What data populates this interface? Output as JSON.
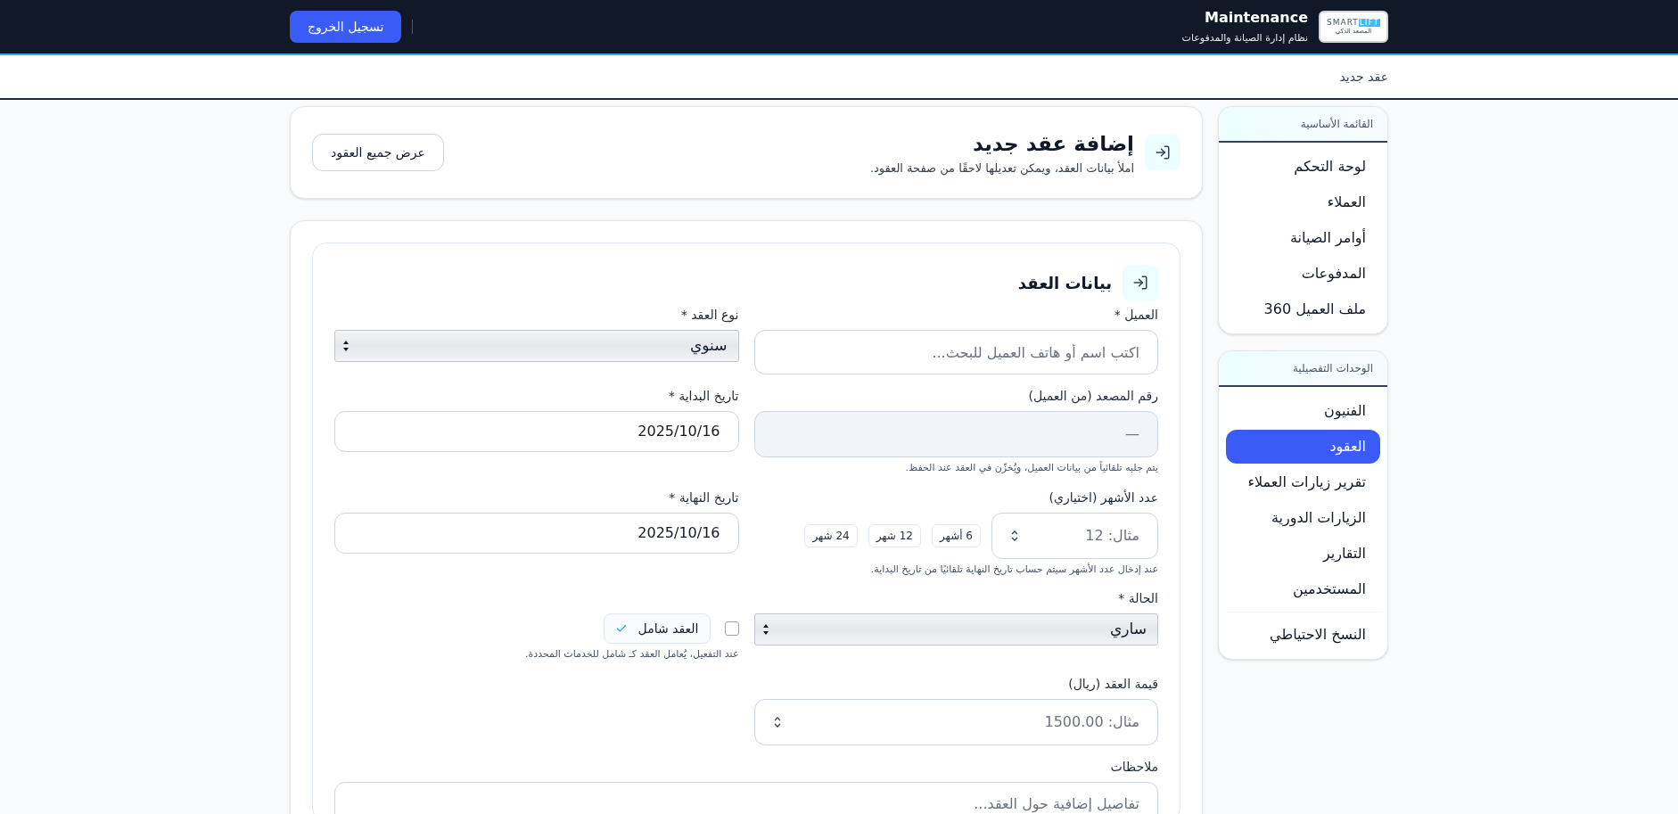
{
  "header": {
    "logo": {
      "word_1": "SMART",
      "word_2": "LIFT",
      "tagline": "المصعد الذكي"
    },
    "title": "Maintenance",
    "subtitle": "نظام إدارة الصيانة والمدفوعات",
    "logout_button": "تسجيل الخروج"
  },
  "breadcrumb": "عقد جديد",
  "sidebar": {
    "sections": [
      {
        "title": "القائمة الأساسية",
        "items": [
          {
            "label": "لوحة التحكم",
            "selected": false
          },
          {
            "label": "العملاء",
            "selected": false
          },
          {
            "label": "أوامر الصيانة",
            "selected": false
          },
          {
            "label": "المدفوعات",
            "selected": false
          },
          {
            "label": "ملف العميل 360",
            "selected": false
          }
        ]
      },
      {
        "title": "الوحدات التفصيلية",
        "items": [
          {
            "label": "الفنيون",
            "selected": false
          },
          {
            "label": "العقود",
            "selected": true
          },
          {
            "label": "تقرير زيارات العملاء",
            "selected": false
          },
          {
            "label": "الزيارات الدورية",
            "selected": false
          },
          {
            "label": "التقارير",
            "selected": false
          },
          {
            "label": "المستخدمين",
            "selected": false
          }
        ],
        "footer_items": [
          {
            "label": "النسخ الاحتياطي",
            "selected": false
          }
        ]
      }
    ]
  },
  "page_header": {
    "title": "إضافة عقد جديد",
    "subtitle": "املأ بيانات العقد، ويمكن تعديلها لاحقًا من صفحة العقود.",
    "button": "عرض جميع العقود"
  },
  "form": {
    "title": "بيانات العقد",
    "rows": [
      {
        "fields": [
          {
            "kind": "text",
            "label": "العميل *",
            "placeholder": "اكتب اسم أو هاتف العميل للبحث..."
          },
          {
            "kind": "select",
            "label": "نوع العقد *",
            "value": "سنوي"
          }
        ]
      },
      {
        "fields": [
          {
            "kind": "readonly",
            "label": "رقم المصعد (من العميل)",
            "value": "—",
            "hint": "يتم جلبه تلقائياً من بيانات العميل، ويُخزّن في العقد عند الحفظ."
          },
          {
            "kind": "date",
            "label": "تاريخ البداية *",
            "value": "2025/10/16"
          }
        ]
      },
      {
        "fields": [
          {
            "kind": "number",
            "label": "عدد الأشهر (اختياري)",
            "placeholder": "مثال: 12",
            "chips": [
              "6 أشهر",
              "12 شهر",
              "24 شهر"
            ],
            "hint": "عند إدخال عدد الأشهر سيتم حساب تاريخ النهاية تلقائيًا من تاريخ البداية."
          },
          {
            "kind": "date",
            "label": "تاريخ النهاية *",
            "value": "2025/10/16"
          }
        ]
      },
      {
        "fields": [
          {
            "kind": "select",
            "label": "الحالة *",
            "value": "ساري"
          },
          {
            "kind": "checkbox",
            "label": "العقد شامل",
            "checked": false,
            "hint": "عند التفعيل، يُعامل العقد كـ شامل للخدمات المحددة."
          }
        ]
      },
      {
        "fields": [
          {
            "kind": "number",
            "label": "قيمة العقد (ريال)",
            "placeholder": "مثال: 1500.00"
          }
        ]
      },
      {
        "fields": [
          {
            "kind": "textarea",
            "label": "ملاحظات",
            "placeholder": "تفاصيل إضافية حول العقد..."
          }
        ]
      }
    ]
  }
}
